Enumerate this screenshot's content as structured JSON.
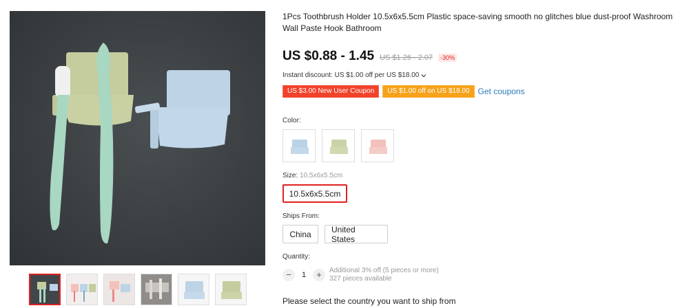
{
  "gallery": {
    "thumbnails": [
      {
        "label": "thumbnail-1",
        "active": true
      },
      {
        "label": "thumbnail-2",
        "active": false
      },
      {
        "label": "thumbnail-3",
        "active": false
      },
      {
        "label": "thumbnail-4",
        "active": false
      },
      {
        "label": "thumbnail-5",
        "active": false
      },
      {
        "label": "thumbnail-6",
        "active": false
      }
    ]
  },
  "product": {
    "title": "1Pcs Toothbrush Holder 10.5x6x5.5cm Plastic space-saving smooth no glitches blue dust-proof Washroom Wall Paste Hook Bathroom",
    "price": "US $0.88 - 1.45",
    "original_price": "US $1.26 - 2.07",
    "discount": "-30%",
    "instant_discount": "Instant discount: US $1.00 off per US $18.00",
    "instant_discount_icon": "chevron-down-icon",
    "coupons": {
      "new_user": "US $3.00 New User Coupon",
      "store": "US $1.00 off on US $18.00",
      "get_coupons": "Get coupons"
    },
    "color_label": "Color:",
    "colors": [
      {
        "name": "blue",
        "hex": "#b9d2e6"
      },
      {
        "name": "green",
        "hex": "#c9d3a8"
      },
      {
        "name": "pink",
        "hex": "#f2c1bb"
      }
    ],
    "size_label": "Size:",
    "size_selected": "10.5x6x5.5cm",
    "size_option": "10.5x6x5.5cm",
    "ships_from_label": "Ships From:",
    "ships_from": [
      "China",
      "United States"
    ],
    "quantity_label": "Quantity:",
    "quantity": "1",
    "quantity_minus": "−",
    "quantity_plus": "+",
    "bulk_offer": "Additional 3% off (5 pieces or more)",
    "available": "327 pieces available",
    "ship_note": "Please select the country you want to ship from"
  },
  "colors": {
    "accent": "#e02020",
    "link": "#2a7bb7",
    "coupon_red": "#f1432b",
    "coupon_orange": "#f7a21b"
  }
}
